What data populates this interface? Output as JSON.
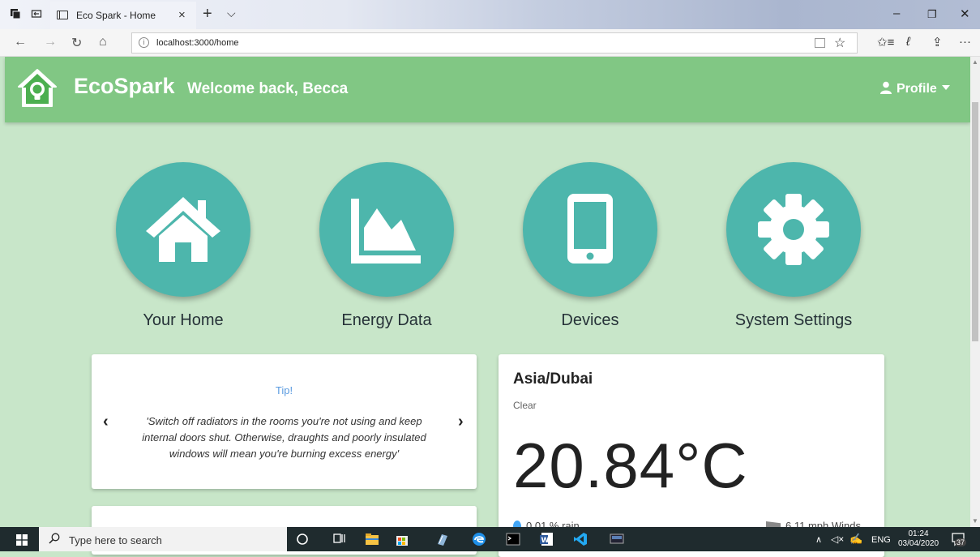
{
  "browser": {
    "tab_title": "Eco Spark - Home",
    "tab_close": "×",
    "new_tab": "+",
    "tab_menu": "⌵",
    "url": "localhost:3000/home",
    "win_minimize": "–",
    "win_restore": "❐",
    "win_close": "✕",
    "nav_back": "←",
    "nav_forward": "→",
    "nav_refresh": "↻",
    "nav_home": "⌂",
    "favorite": "☆",
    "favorites_bar": "✩≡",
    "pen": "ℓ",
    "share": "⇪",
    "more": "···"
  },
  "header": {
    "brand": "EcoSpark",
    "welcome": "Welcome back, Becca",
    "profile_label": "Profile"
  },
  "tiles": [
    {
      "label": "Your Home",
      "icon": "home-icon"
    },
    {
      "label": "Energy Data",
      "icon": "area-chart-icon"
    },
    {
      "label": "Devices",
      "icon": "mobile-icon"
    },
    {
      "label": "System Settings",
      "icon": "cog-icon"
    }
  ],
  "tip": {
    "title": "Tip!",
    "text": "'Switch off radiators in the rooms you're not using and keep internal doors shut. Otherwise, draughts and poorly insulated windows will mean you're burning excess energy'",
    "prev": "‹",
    "next": "›"
  },
  "weather": {
    "city": "Asia/Dubai",
    "condition": "Clear",
    "temperature": "20.84°C",
    "rain": "0.01 % rain",
    "wind": "6.11 mph Winds"
  },
  "taskbar": {
    "search_placeholder": "Type here to search",
    "lang": "ENG",
    "time": "01:24",
    "date": "03/04/2020",
    "notifications": "37",
    "tray_chevron": "∧",
    "volume": "◁×",
    "pen": "✍"
  },
  "colors": {
    "header": "#81c784",
    "background": "#c8e6c9",
    "tile": "#4db6ac",
    "tip_title": "#5b9be0"
  }
}
